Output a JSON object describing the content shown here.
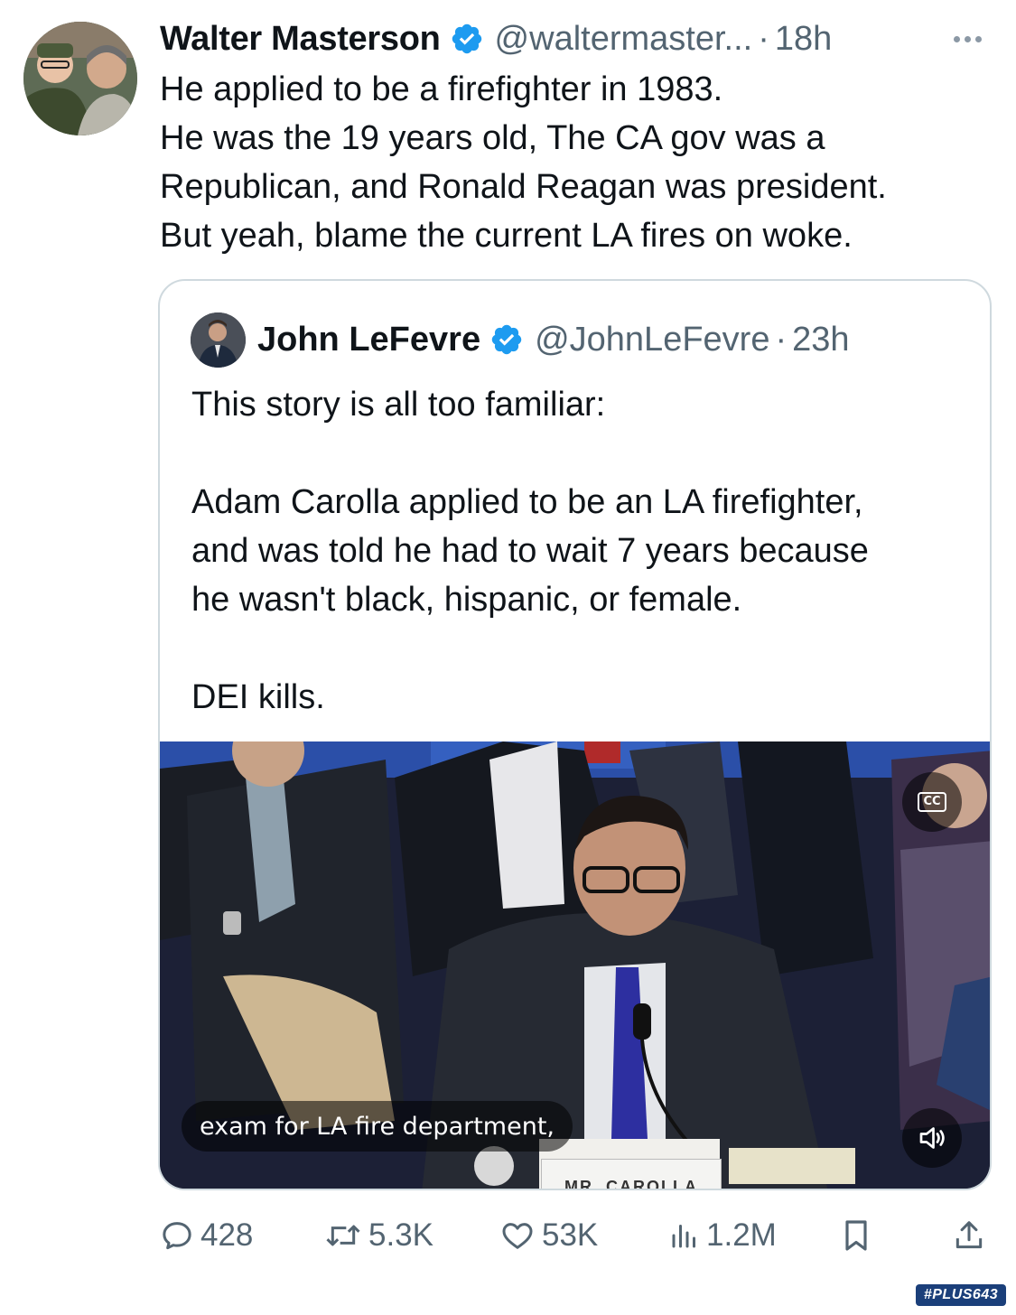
{
  "tweet": {
    "author_name": "Walter Masterson",
    "handle": "@waltermaster...",
    "separator": "·",
    "time": "18h",
    "lines": [
      "He applied to be a firefighter in 1983.",
      "He was the 19 years old, The CA gov was a",
      "Republican, and Ronald Reagan was president.",
      "But yeah, blame the current LA fires on woke."
    ]
  },
  "quote": {
    "author_name": "John LeFevre",
    "handle": "@JohnLeFevre",
    "separator": "·",
    "time": "23h",
    "lines": [
      "This story is all too familiar:",
      "",
      "Adam Carolla applied to be an LA firefighter,",
      "and was told he had to wait 7 years because",
      "he wasn't black, hispanic, or female.",
      "",
      "DEI kills."
    ],
    "video": {
      "cc_label": "CC",
      "caption": "exam for LA fire department,",
      "nameplate": "MR. CAROLLA"
    }
  },
  "actions": {
    "replies": "428",
    "reposts": "5.3K",
    "likes": "53K",
    "views": "1.2M"
  },
  "watermark": "#PLUS643",
  "colors": {
    "verified": "#1d9bf0",
    "text": "#0f1419",
    "secondary": "#536471",
    "border": "#cfd9de"
  },
  "icons": [
    "verified-badge-icon",
    "more-icon",
    "cc-icon",
    "volume-icon",
    "reply-icon",
    "repost-icon",
    "like-icon",
    "views-icon",
    "bookmark-icon",
    "share-icon"
  ]
}
